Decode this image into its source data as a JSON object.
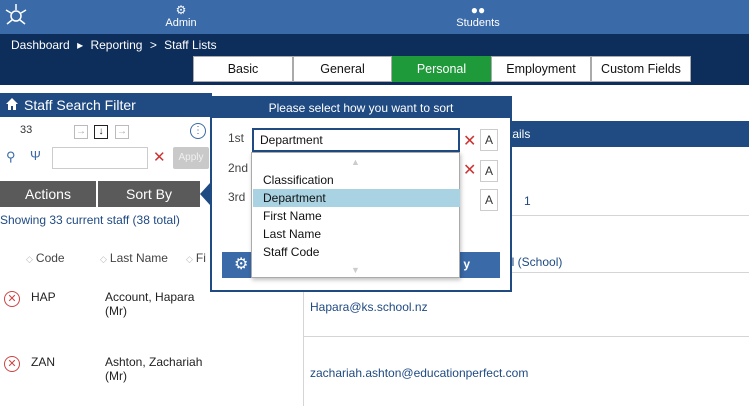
{
  "topnav": {
    "admin_label": "Admin",
    "students_label": "Students"
  },
  "breadcrumb": {
    "items": [
      "Dashboard",
      "Reporting",
      "Staff Lists"
    ],
    "separators": [
      "▸",
      ">"
    ]
  },
  "tabs": [
    {
      "label": "Basic",
      "active": false
    },
    {
      "label": "General",
      "active": false
    },
    {
      "label": "Personal",
      "active": true
    },
    {
      "label": "Employment",
      "active": false
    },
    {
      "label": "Custom Fields",
      "active": false
    }
  ],
  "left_panel": {
    "title": "Staff Search Filter",
    "count": "33",
    "filter_value": "",
    "apply_label": "Apply",
    "actions_label": "Actions",
    "sort_by_label": "Sort By",
    "showing_text": "Showing 33 current staff (38 total)",
    "columns": [
      "Code",
      "Last Name",
      "Fi"
    ],
    "rows": [
      {
        "code": "HAP",
        "name": "Account, Hapara (Mr)"
      },
      {
        "code": "ZAN",
        "name": "Ashton, Zachariah (Mr)"
      }
    ]
  },
  "right_panel": {
    "header_fragment": "tails",
    "number": "1",
    "email_col_fragment": "il (School)",
    "emails": [
      "Hapara@ks.school.nz",
      "zachariah.ashton@educationperfect.com"
    ]
  },
  "sort_dialog": {
    "title": "Please select how you want to sort",
    "labels": [
      "1st",
      "2nd",
      "3rd"
    ],
    "first_value": "Department",
    "a_label": "A",
    "bottom_fragment": "y",
    "options": [
      "Classification",
      "Department",
      "First Name",
      "Last Name",
      "Staff Code"
    ],
    "selected_option": "Department"
  },
  "colors": {
    "topbar": "#3a6aa8",
    "navy": "#0d2d5a",
    "panel_header": "#1f4a82",
    "active_tab": "#1e9a3a",
    "dropdown_selected": "#a9d3e3",
    "delete_red": "#c44"
  }
}
